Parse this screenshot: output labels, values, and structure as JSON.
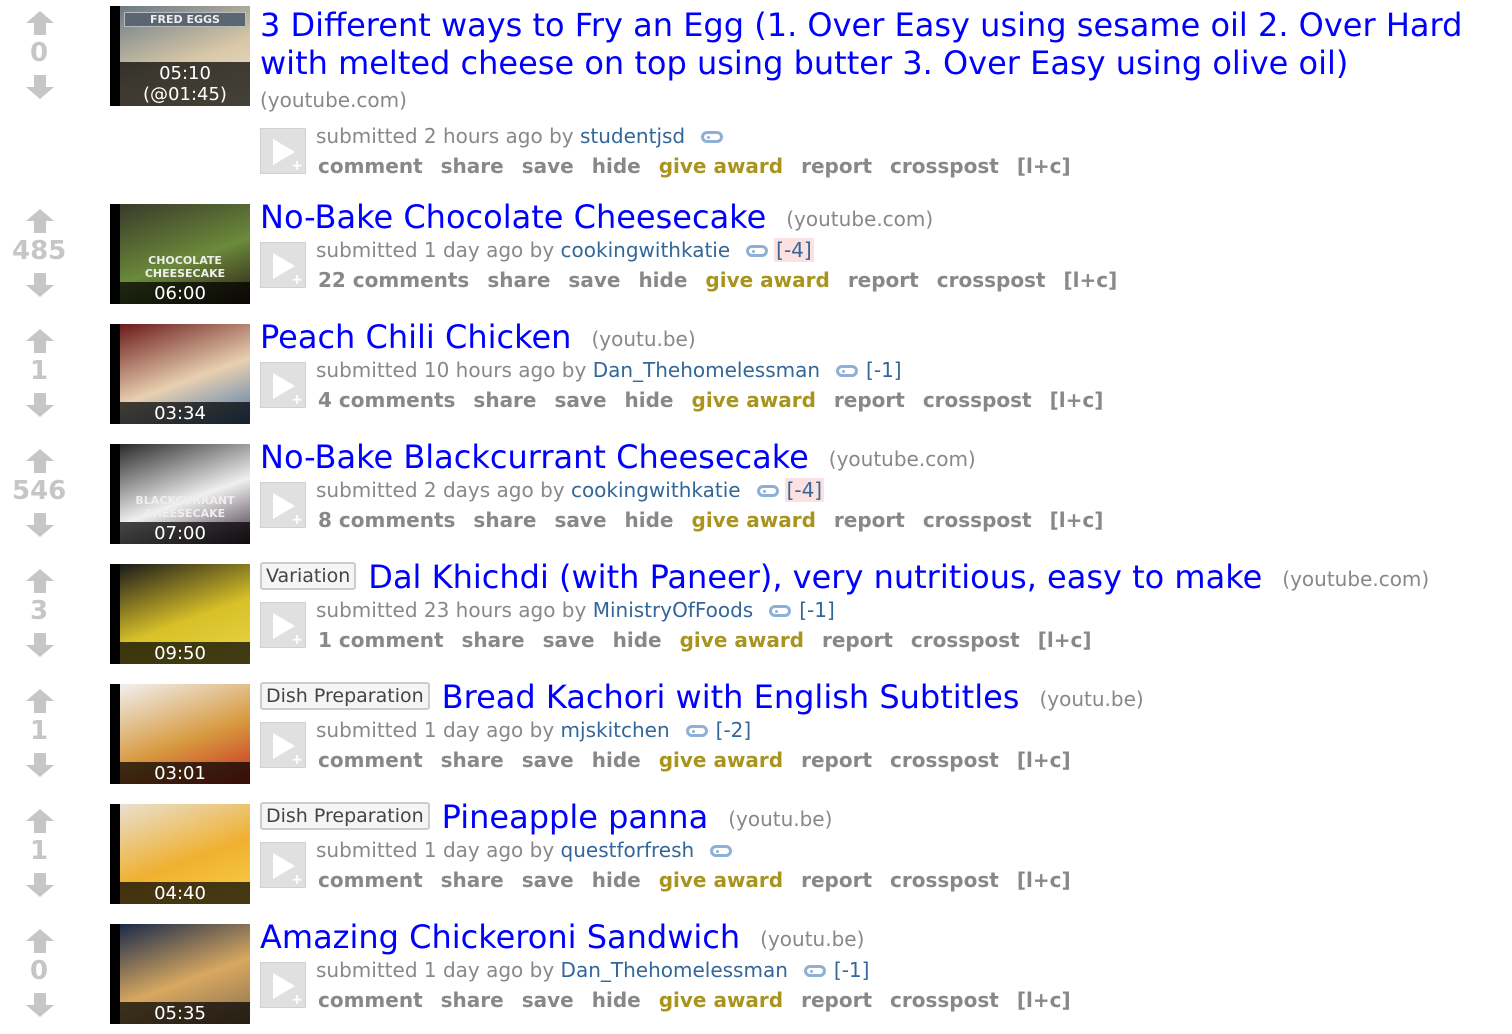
{
  "posts": [
    {
      "score": "0",
      "thumb_duration": "05:10",
      "thumb_timestamp": "(@01:45)",
      "thumb_caption": "FRED EGGS",
      "title": "3 Different ways to Fry an Egg (1. Over Easy using sesame oil 2. Over Hard with melted cheese on top using butter 3. Over Easy using olive oil)",
      "domain": "(youtube.com)",
      "flair": "",
      "submitted": "submitted 2 hours ago by",
      "author": "studentjsd",
      "karma": "",
      "comments": "comment",
      "share": "share",
      "save": "save",
      "hide": "hide",
      "award": "give award",
      "report": "report",
      "crosspost": "crosspost",
      "lc": "[l+c]"
    },
    {
      "score": "485",
      "thumb_duration": "06:00",
      "thumb_caption": "CHOCOLATE CHEESECAKE",
      "title": "No-Bake Chocolate Cheesecake",
      "domain": "(youtube.com)",
      "flair": "",
      "submitted": "submitted 1 day ago by",
      "author": "cookingwithkatie",
      "karma": "[-4]",
      "comments": "22 comments",
      "share": "share",
      "save": "save",
      "hide": "hide",
      "award": "give award",
      "report": "report",
      "crosspost": "crosspost",
      "lc": "[l+c]"
    },
    {
      "score": "1",
      "thumb_duration": "03:34",
      "title": "Peach Chili Chicken",
      "domain": "(youtu.be)",
      "flair": "",
      "submitted": "submitted 10 hours ago by",
      "author": "Dan_Thehomelessman",
      "karma": "[-1]",
      "comments": "4 comments",
      "share": "share",
      "save": "save",
      "hide": "hide",
      "award": "give award",
      "report": "report",
      "crosspost": "crosspost",
      "lc": "[l+c]"
    },
    {
      "score": "546",
      "thumb_duration": "07:00",
      "thumb_caption": "BLACKCURRANT CHEESECAKE",
      "title": "No-Bake Blackcurrant Cheesecake",
      "domain": "(youtube.com)",
      "flair": "",
      "submitted": "submitted 2 days ago by",
      "author": "cookingwithkatie",
      "karma": "[-4]",
      "comments": "8 comments",
      "share": "share",
      "save": "save",
      "hide": "hide",
      "award": "give award",
      "report": "report",
      "crosspost": "crosspost",
      "lc": "[l+c]"
    },
    {
      "score": "3",
      "thumb_duration": "09:50",
      "title": "Dal Khichdi (with Paneer), very nutritious, easy to make",
      "domain": "(youtube.com)",
      "flair": "Variation",
      "submitted": "submitted 23 hours ago by",
      "author": "MinistryOfFoods",
      "karma": "[-1]",
      "comments": "1 comment",
      "share": "share",
      "save": "save",
      "hide": "hide",
      "award": "give award",
      "report": "report",
      "crosspost": "crosspost",
      "lc": "[l+c]"
    },
    {
      "score": "1",
      "thumb_duration": "03:01",
      "title": "Bread Kachori with English Subtitles",
      "domain": "(youtu.be)",
      "flair": "Dish Preparation",
      "submitted": "submitted 1 day ago by",
      "author": "mjskitchen",
      "karma": "[-2]",
      "comments": "comment",
      "share": "share",
      "save": "save",
      "hide": "hide",
      "award": "give award",
      "report": "report",
      "crosspost": "crosspost",
      "lc": "[l+c]"
    },
    {
      "score": "1",
      "thumb_duration": "04:40",
      "title": "Pineapple panna",
      "domain": "(youtu.be)",
      "flair": "Dish Preparation",
      "submitted": "submitted 1 day ago by",
      "author": "questforfresh",
      "karma": "",
      "comments": "comment",
      "share": "share",
      "save": "save",
      "hide": "hide",
      "award": "give award",
      "report": "report",
      "crosspost": "crosspost",
      "lc": "[l+c]"
    },
    {
      "score": "0",
      "thumb_duration": "05:35",
      "title": "Amazing Chickeroni Sandwich",
      "domain": "(youtu.be)",
      "flair": "",
      "submitted": "submitted 1 day ago by",
      "author": "Dan_Thehomelessman",
      "karma": "[-1]",
      "comments": "comment",
      "share": "share",
      "save": "save",
      "hide": "hide",
      "award": "give award",
      "report": "report",
      "crosspost": "crosspost",
      "lc": "[l+c]"
    }
  ],
  "colors": {
    "title_link": "#0000ff",
    "author_link": "#336699",
    "award": "#a8941f",
    "muted": "#888888",
    "vote_arrow": "#c6c6c6"
  },
  "icons": {
    "upvote": "arrow-up-icon",
    "downvote": "arrow-down-icon",
    "play": "play-expando-icon",
    "tag": "user-tag-icon"
  }
}
